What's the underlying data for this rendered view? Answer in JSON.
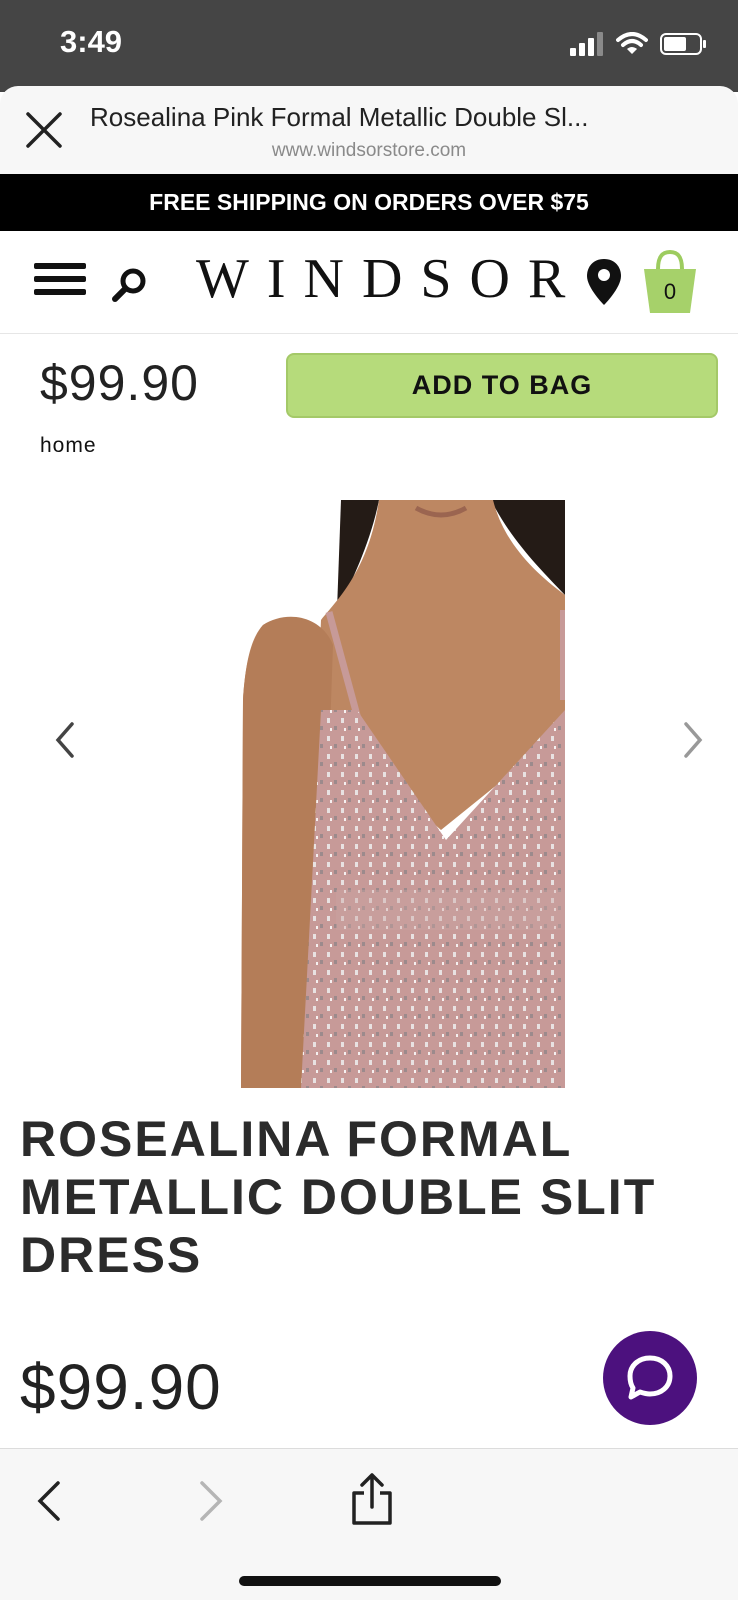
{
  "status_bar": {
    "time": "3:49"
  },
  "browser": {
    "title": "Rosealina Pink Formal Metallic Double Sl...",
    "url": "www.windsorstore.com"
  },
  "promo_banner": "FREE SHIPPING ON ORDERS OVER $75",
  "header": {
    "logo": "WINDSOR",
    "bag_count": "0"
  },
  "product": {
    "price_top": "$99.90",
    "add_to_bag": "ADD TO BAG",
    "breadcrumb": "home",
    "title": "ROSEALINA FORMAL METALLIC DOUBLE SLIT DRESS",
    "price_bottom": "$99.90"
  },
  "colors": {
    "accent_green": "#b6db7b",
    "chat_purple": "#4c117e",
    "status_bar_gray": "#454545",
    "dress_pink": "#c79a98"
  },
  "icons": [
    "close-icon",
    "menu-icon",
    "search-icon",
    "location-pin-icon",
    "shopping-bag-icon",
    "chevron-left-icon",
    "chevron-right-icon",
    "chat-icon",
    "share-icon"
  ]
}
